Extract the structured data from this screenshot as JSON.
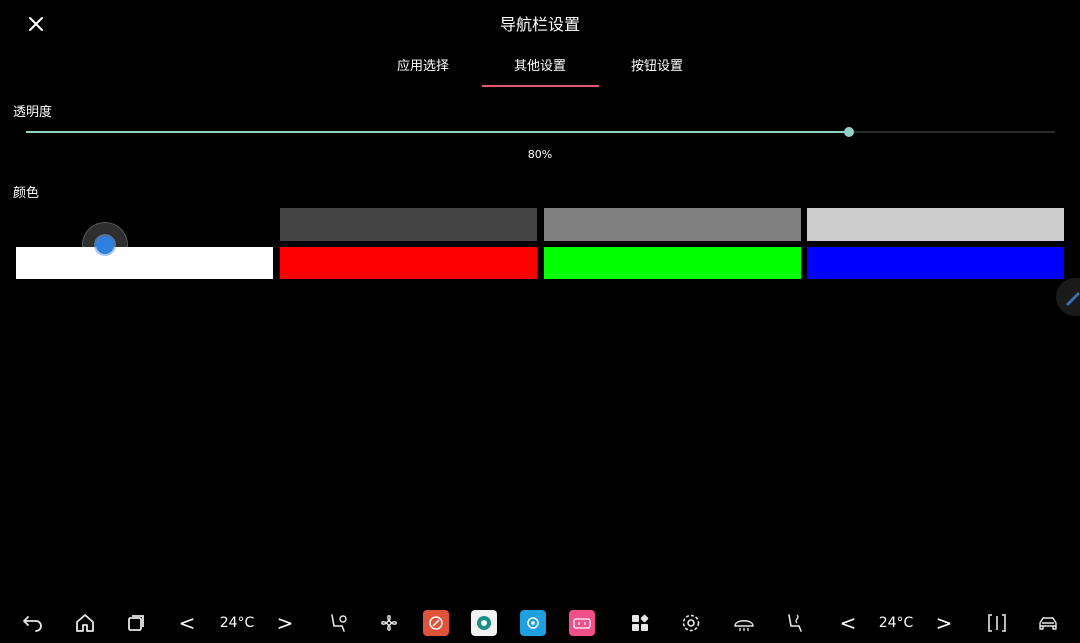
{
  "header": {
    "title": "导航栏设置"
  },
  "tabs": [
    {
      "label": "应用选择"
    },
    {
      "label": "其他设置"
    },
    {
      "label": "按钮设置"
    }
  ],
  "opacity": {
    "label": "透明度",
    "value_text": "80%",
    "value": 0.8
  },
  "color": {
    "label": "颜色",
    "swatches": [
      "#ffffff",
      "#444444",
      "#808080",
      "#cccccc",
      "#ff0000",
      "#00ff00",
      "#0000ff"
    ]
  },
  "bottom_bar": {
    "left_temp": "24°C",
    "right_temp": "24°C",
    "left_prev": "<",
    "left_next": ">",
    "right_prev": "<",
    "right_next": ">",
    "icons": [
      "back-icon",
      "home-icon",
      "recents-icon",
      "seat-fan-icon",
      "fan-icon",
      "app-red-icon",
      "app-teal-icon",
      "app-blue-icon",
      "bilibili-icon",
      "apps-grid-icon",
      "settings-icon",
      "defrost-icon",
      "seat-heat-icon",
      "split-screen-icon",
      "car-icon"
    ]
  }
}
